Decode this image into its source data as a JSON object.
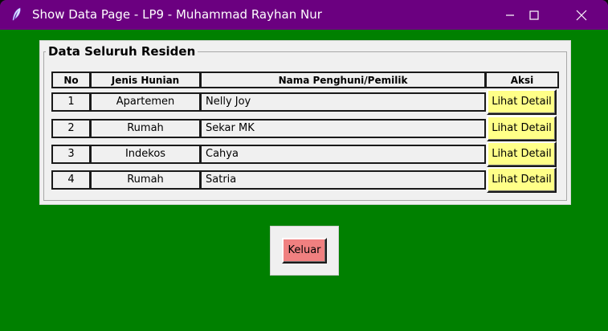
{
  "window": {
    "title": "Show Data Page - LP9 - Muhammad Rayhan Nur",
    "colors": {
      "titlebar": "#6b0080",
      "background": "#008000",
      "detail_button": "#ffff88",
      "exit_button": "#f08080"
    }
  },
  "group": {
    "legend": "Data Seluruh Residen"
  },
  "table": {
    "headers": [
      "No",
      "Jenis Hunian",
      "Nama Penghuni/Pemilik",
      "Aksi"
    ],
    "rows": [
      {
        "no": "1",
        "jenis": "Apartemen",
        "nama": "Nelly Joy",
        "aksi": "Lihat Detail"
      },
      {
        "no": "2",
        "jenis": "Rumah",
        "nama": "Sekar MK",
        "aksi": "Lihat Detail"
      },
      {
        "no": "3",
        "jenis": "Indekos",
        "nama": "Cahya",
        "aksi": "Lihat Detail"
      },
      {
        "no": "4",
        "jenis": "Rumah",
        "nama": "Satria",
        "aksi": "Lihat Detail"
      }
    ]
  },
  "actions": {
    "exit_label": "Keluar"
  },
  "icons": {
    "app": "feather-icon",
    "minimize": "minimize-icon",
    "maximize": "maximize-icon",
    "close": "close-icon"
  }
}
